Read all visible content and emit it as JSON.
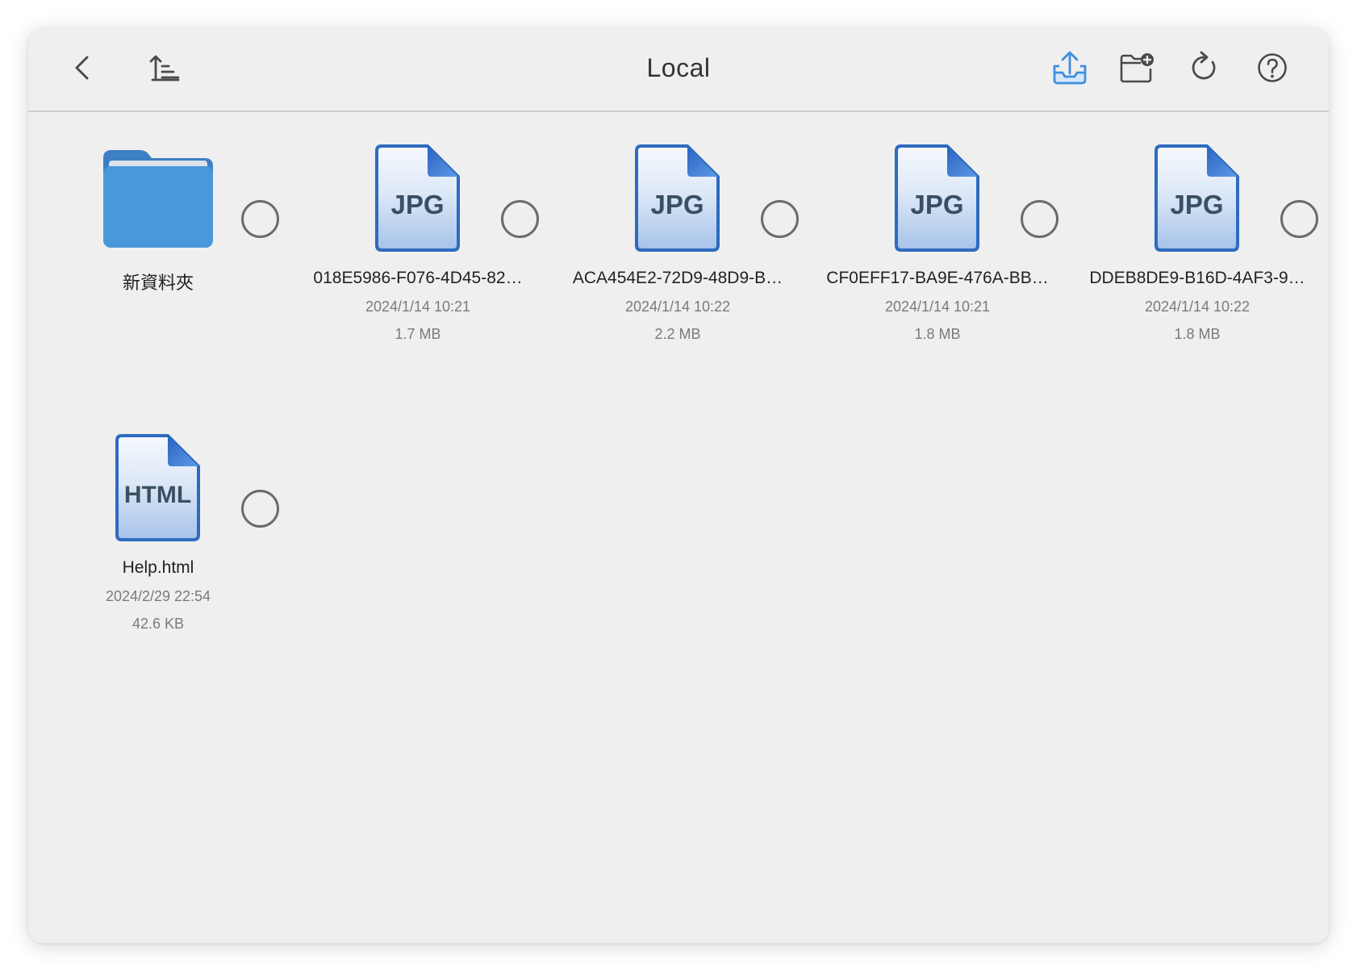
{
  "header": {
    "title": "Local",
    "icons": {
      "back": "back-icon",
      "sort": "sort-icon",
      "upload": "upload-icon",
      "new_folder": "new-folder-icon",
      "refresh": "refresh-icon",
      "help": "help-icon"
    }
  },
  "colors": {
    "accent": "#3d8fe0",
    "file_border": "#2e6bbf",
    "folder": "#4a98dc",
    "window_bg": "#efefef",
    "text": "#222222",
    "meta_text": "#7a7a7a"
  },
  "items": [
    {
      "type": "folder",
      "icon": "folder-icon",
      "name": "新資料夾",
      "selected": false
    },
    {
      "type": "file",
      "icon": "jpg-file-icon",
      "badge": "JPG",
      "name": "018E5986-F076-4D45-82…",
      "date": "2024/1/14 10:21",
      "size": "1.7 MB",
      "selected": false
    },
    {
      "type": "file",
      "icon": "jpg-file-icon",
      "badge": "JPG",
      "name": "ACA454E2-72D9-48D9-B…",
      "date": "2024/1/14 10:22",
      "size": "2.2 MB",
      "selected": false
    },
    {
      "type": "file",
      "icon": "jpg-file-icon",
      "badge": "JPG",
      "name": "CF0EFF17-BA9E-476A-BB…",
      "date": "2024/1/14 10:21",
      "size": "1.8 MB",
      "selected": false
    },
    {
      "type": "file",
      "icon": "jpg-file-icon",
      "badge": "JPG",
      "name": "DDEB8DE9-B16D-4AF3-9…",
      "date": "2024/1/14 10:22",
      "size": "1.8 MB",
      "selected": false
    },
    {
      "type": "file",
      "icon": "html-file-icon",
      "badge": "HTML",
      "name": "Help.html",
      "date": "2024/2/29 22:54",
      "size": "42.6 KB",
      "selected": false
    }
  ]
}
